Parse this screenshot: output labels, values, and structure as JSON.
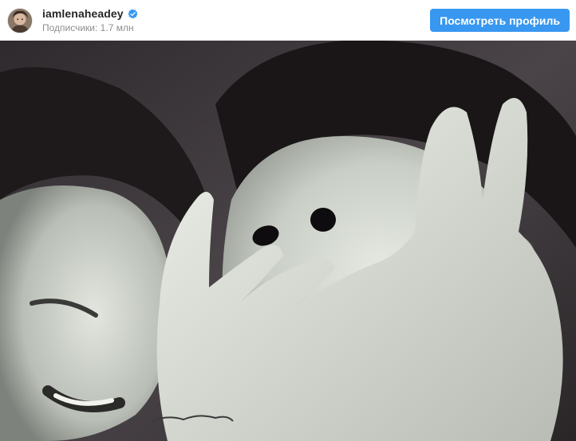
{
  "header": {
    "username": "iamlenaheadey",
    "verified": true,
    "followers_text": "Подписчики: 1.7 млн",
    "profile_button_label": "Посмотреть профиль"
  },
  "post": {
    "image_kind": "photo"
  },
  "colors": {
    "button_bg": "#3897f0",
    "username": "#262626",
    "secondary_text": "#8e8e8e",
    "verified_badge": "#3897f0"
  },
  "icons": {
    "verified": "verified-badge-icon",
    "avatar": "avatar-image"
  }
}
